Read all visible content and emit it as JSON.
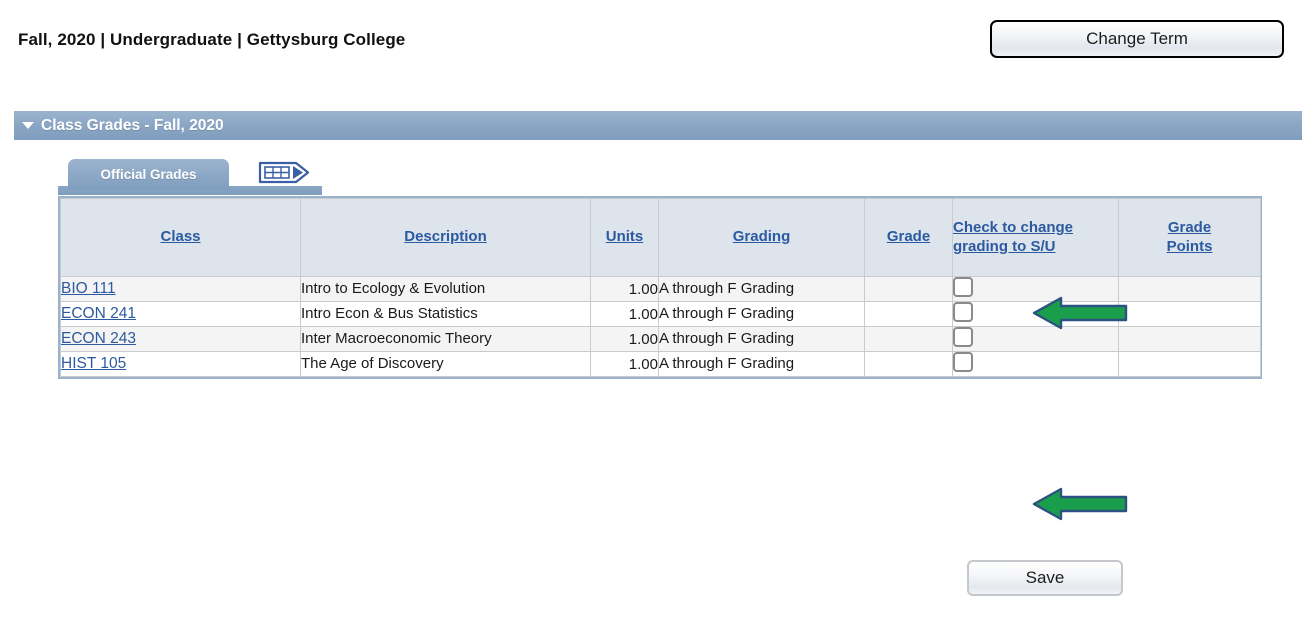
{
  "page": {
    "title": "Fall, 2020 | Undergraduate | Gettysburg College"
  },
  "toolbar": {
    "change_term_label": "Change Term",
    "save_label": "Save"
  },
  "section": {
    "header_title": "Class Grades - Fall, 2020",
    "collapse_icon": "triangle-down-icon"
  },
  "tabs": [
    {
      "label": "Official Grades",
      "selected": true
    }
  ],
  "tab_tools": {
    "grid_view_icon": "grid-view-icon"
  },
  "table": {
    "columns": [
      {
        "key": "class",
        "label": "Class"
      },
      {
        "key": "description",
        "label": "Description"
      },
      {
        "key": "units",
        "label": "Units"
      },
      {
        "key": "grading",
        "label": "Grading"
      },
      {
        "key": "grade",
        "label": "Grade"
      },
      {
        "key": "check_su",
        "label": "Check to change grading to S/U"
      },
      {
        "key": "grade_points",
        "label": "Grade Points"
      }
    ],
    "rows": [
      {
        "class": "BIO 111",
        "description": "Intro to Ecology & Evolution",
        "units": "1.00",
        "grading": "A through F Grading",
        "grade": "",
        "check_su_checked": false,
        "grade_points": ""
      },
      {
        "class": "ECON 241",
        "description": "Intro Econ & Bus Statistics",
        "units": "1.00",
        "grading": "A through F Grading",
        "grade": "",
        "check_su_checked": false,
        "grade_points": ""
      },
      {
        "class": "ECON 243",
        "description": "Inter Macroeconomic Theory",
        "units": "1.00",
        "grading": "A through F Grading",
        "grade": "",
        "check_su_checked": false,
        "grade_points": ""
      },
      {
        "class": "HIST 105",
        "description": "The Age of Discovery",
        "units": "1.00",
        "grading": "A through F Grading",
        "grade": "",
        "check_su_checked": false,
        "grade_points": ""
      }
    ]
  },
  "annotations": [
    {
      "name": "green-arrow-icon",
      "direction": "left",
      "points_at": "row-1-su-checkbox"
    },
    {
      "name": "green-arrow-icon",
      "direction": "left",
      "points_at": "row-4-su-checkbox"
    }
  ],
  "colors": {
    "header_bar": "#89a5c3",
    "table_header": "#dde4ec",
    "link": "#2c5aa0",
    "row_alt": "#f4f4f4",
    "annotation_green": "#1a9e4b",
    "annotation_outline": "#2c5282"
  }
}
